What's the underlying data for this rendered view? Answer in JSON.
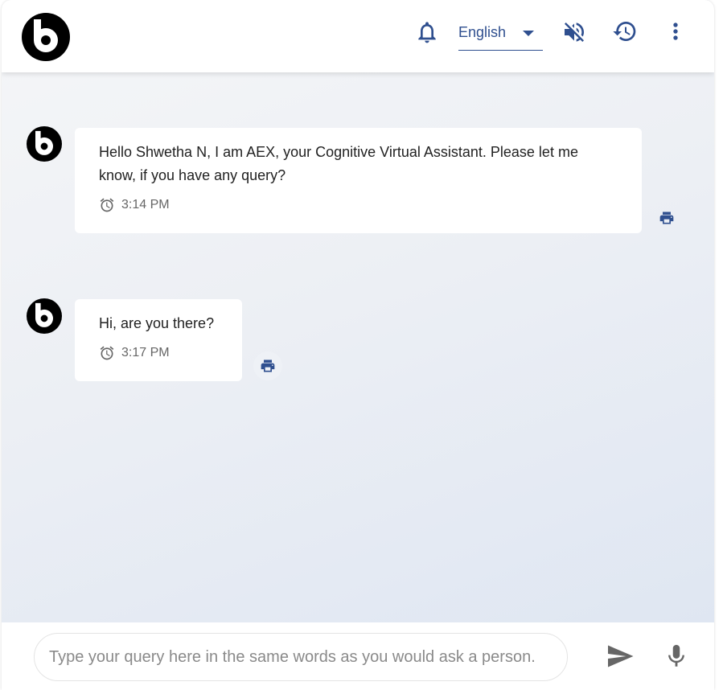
{
  "header": {
    "language": "English",
    "icons": [
      "bell-icon",
      "caret-down-icon",
      "volume-mute-icon",
      "history-icon",
      "more-vert-icon"
    ]
  },
  "messages": [
    {
      "lines": [
        "Hello Shwetha N, I am AEX, your Cognitive Virtual Assistant. Please let me",
        "know, if you have any query?"
      ],
      "time": "3:14 PM"
    },
    {
      "lines": [
        "Hi, are you there?"
      ],
      "time": "3:17 PM"
    }
  ],
  "footer": {
    "placeholder": "Type your query here in the same words as you would ask a person."
  },
  "colors": {
    "accent": "#2f4f8f",
    "logo": "#000000",
    "bubble": "#ffffff"
  }
}
